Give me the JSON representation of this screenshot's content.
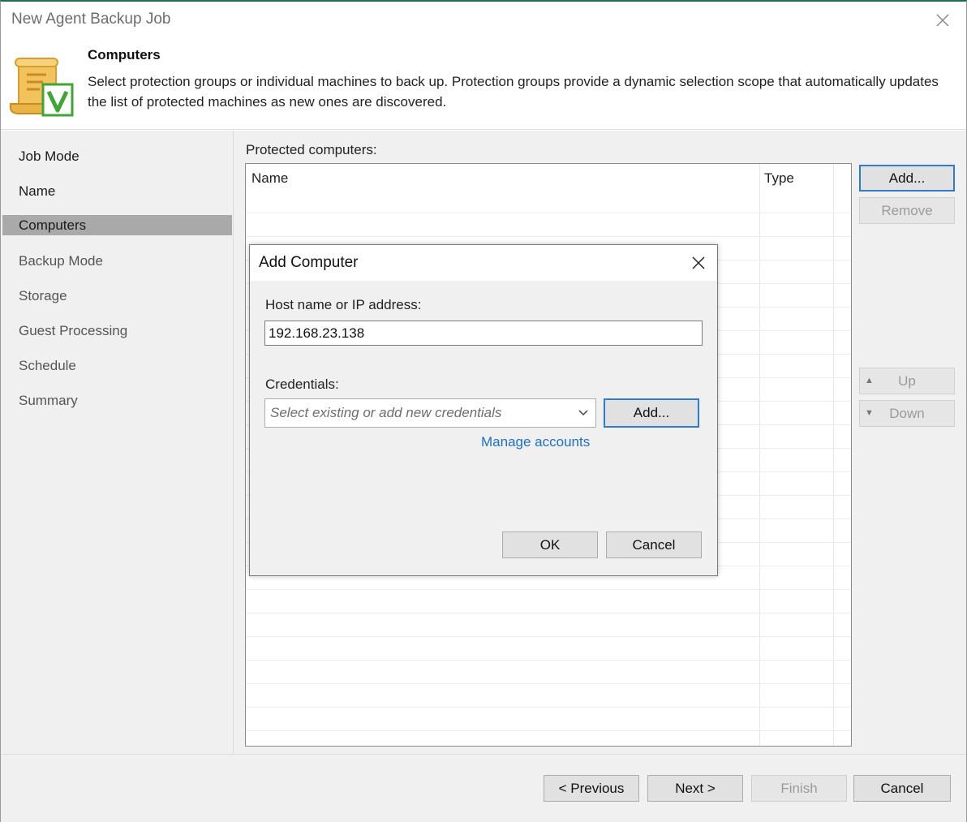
{
  "window": {
    "title": "New Agent Backup Job"
  },
  "header": {
    "title": "Computers",
    "description": "Select protection groups or individual machines to back up. Protection groups provide a dynamic selection scope that automatically updates the list of protected machines as new ones are discovered."
  },
  "sidebar": {
    "items": [
      {
        "label": "Job Mode",
        "state": "done"
      },
      {
        "label": "Name",
        "state": "done"
      },
      {
        "label": "Computers",
        "state": "active"
      },
      {
        "label": "Backup Mode",
        "state": "pending"
      },
      {
        "label": "Storage",
        "state": "pending"
      },
      {
        "label": "Guest Processing",
        "state": "pending"
      },
      {
        "label": "Schedule",
        "state": "pending"
      },
      {
        "label": "Summary",
        "state": "pending"
      }
    ]
  },
  "main": {
    "list_label": "Protected computers:",
    "columns": [
      "Name",
      "Type"
    ],
    "buttons": {
      "add": "Add...",
      "remove": "Remove",
      "up": "Up",
      "down": "Down"
    }
  },
  "footer": {
    "previous": "< Previous",
    "next": "Next >",
    "finish": "Finish",
    "cancel": "Cancel"
  },
  "dialog": {
    "title": "Add Computer",
    "host_label": "Host name or IP address:",
    "host_value": "192.168.23.138",
    "credentials_label": "Credentials:",
    "credentials_placeholder": "Select existing or add new credentials",
    "add_button": "Add...",
    "manage_link": "Manage accounts",
    "ok": "OK",
    "cancel": "Cancel"
  },
  "colors": {
    "accent": "#2f7bc9",
    "link": "#1f6fc5",
    "active_nav": "#a9a9a9",
    "title_border": "#1e6b52",
    "logo_green": "#3fa535",
    "logo_gold": "#e8b545"
  },
  "icons": [
    "close-icon",
    "job-scroll-icon",
    "chevron-down-icon",
    "arrow-up-icon",
    "arrow-down-icon"
  ]
}
